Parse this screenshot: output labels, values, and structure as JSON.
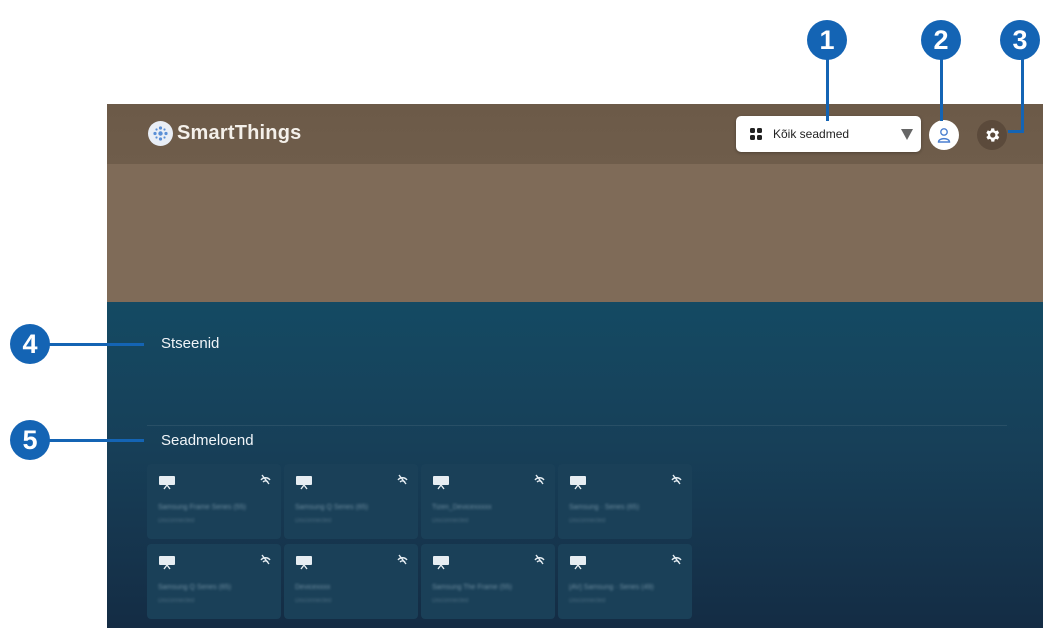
{
  "app": {
    "name": "SmartThings"
  },
  "header": {
    "location_dropdown": {
      "label": "Kõik seadmed",
      "icon": "grid-icon"
    },
    "profile_icon": "person-icon",
    "settings_icon": "gear-icon"
  },
  "sections": {
    "scenes_title": "Stseenid",
    "devices_title": "Seadmeloend"
  },
  "devices": [
    {
      "name": "Samsung Frame Series (55)",
      "status": "Disconnected"
    },
    {
      "name": "Samsung Q Series (65)",
      "status": "Disconnected"
    },
    {
      "name": "Tizen_Devicexxxxx",
      "status": "Disconnected"
    },
    {
      "name": "Samsung · Series (65)",
      "status": "Disconnected"
    },
    {
      "name": "Samsung Q Series (65)",
      "status": "Disconnected"
    },
    {
      "name": "Devicexxxx",
      "status": "Disconnected"
    },
    {
      "name": "Samsung The Frame (55)",
      "status": "Disconnected"
    },
    {
      "name": "[AV] Samsung · Series (49)",
      "status": "Disconnected"
    }
  ],
  "callouts": [
    "1",
    "2",
    "3",
    "4",
    "5"
  ],
  "colors": {
    "callout_blue": "#1464b4",
    "header_brown": "#6c5a48",
    "hero_brown": "#7f6b58",
    "panel_navy": "#173f58",
    "tile": "#1a4058"
  }
}
